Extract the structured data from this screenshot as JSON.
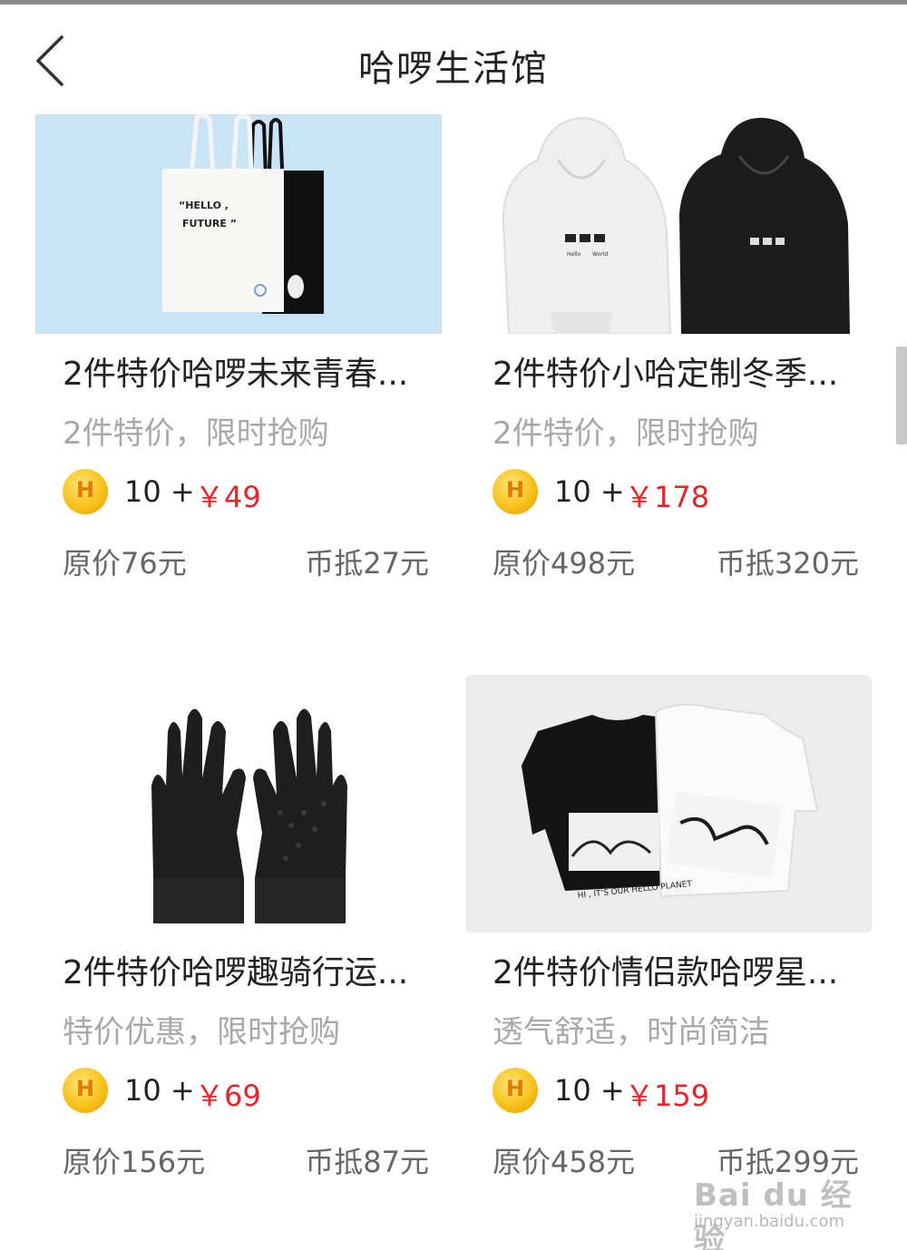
{
  "header": {
    "title": "哈啰生活馆"
  },
  "products": [
    {
      "name": "2件特价哈啰未来青春...",
      "subtitle": "2件特价，限时抢购",
      "coin_badge": "H",
      "coin_count": "10 +",
      "price": "￥49",
      "original_price": "原价76元",
      "coin_deduct": "币抵27元"
    },
    {
      "name": "2件特价小哈定制冬季...",
      "subtitle": "2件特价，限时抢购",
      "coin_badge": "H",
      "coin_count": "10 +",
      "price": "￥178",
      "original_price": "原价498元",
      "coin_deduct": "币抵320元"
    },
    {
      "name": "2件特价哈啰趣骑行运...",
      "subtitle": "特价优惠，限时抢购",
      "coin_badge": "H",
      "coin_count": "10 +",
      "price": "￥69",
      "original_price": "原价156元",
      "coin_deduct": "币抵87元"
    },
    {
      "name": "2件特价情侣款哈啰星...",
      "subtitle": "透气舒适，时尚简洁",
      "coin_badge": "H",
      "coin_count": "10 +",
      "price": "￥159",
      "original_price": "原价458元",
      "coin_deduct": "币抵299元"
    }
  ],
  "product_images": {
    "tote_print": [
      "“HELLO ,",
      "FUTURE ”"
    ],
    "hoodie_print": [
      "Hello",
      "World"
    ],
    "tshirt_print": [
      "HI , IT'S OUR HELLO PLANET"
    ]
  },
  "watermark": {
    "brand": "Bai du 经验",
    "url": "jingyan.baidu.com"
  },
  "colors": {
    "price_red": "#e8232a",
    "coin_gold": "#f7c21a",
    "muted_gray": "#a8a8a8"
  }
}
